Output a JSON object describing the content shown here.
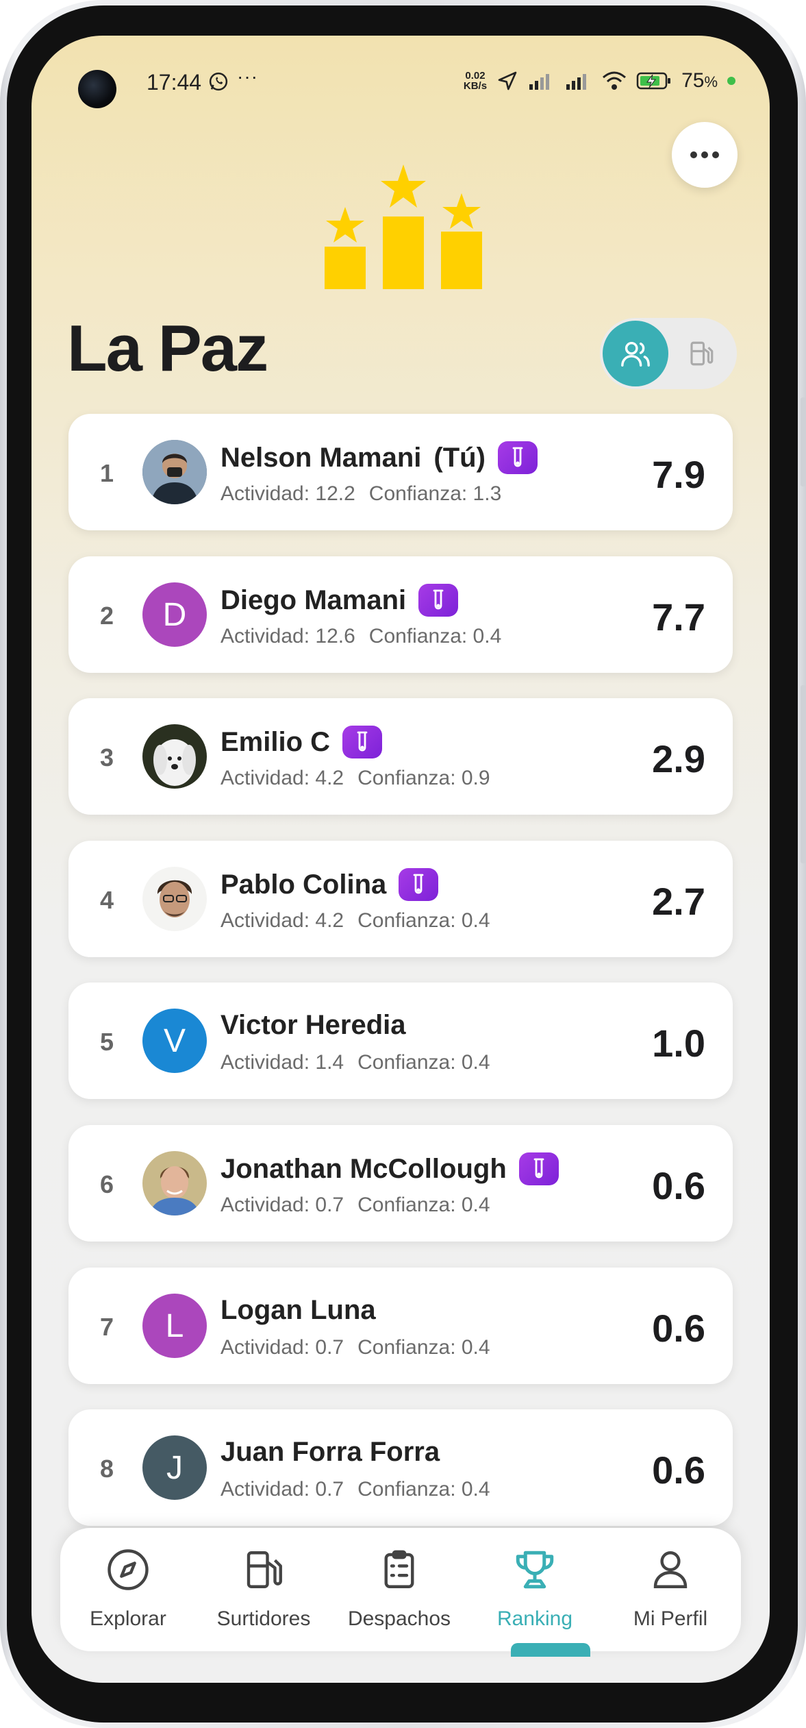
{
  "status_bar": {
    "time": "17:44",
    "more": "···",
    "net_speed_top": "0.02",
    "net_speed_bottom": "KB/s",
    "battery": "75",
    "battery_unit": "%"
  },
  "header": {
    "title": "La Paz"
  },
  "colors": {
    "accent": "#3aafb5",
    "trophy": "#ffd000",
    "badge": "#9230e0"
  },
  "ranking": [
    {
      "rank": "1",
      "name": "Nelson Mamani",
      "suffix": "(Tú)",
      "activity": "Actividad: 12.2",
      "trust": "Confianza: 1.3",
      "score": "7.9",
      "badge": true,
      "avatar": "photo"
    },
    {
      "rank": "2",
      "name": "Diego Mamani",
      "suffix": "",
      "activity": "Actividad: 12.6",
      "trust": "Confianza: 0.4",
      "score": "7.7",
      "badge": true,
      "avatar": "D",
      "avatar_color": "#ab47bc"
    },
    {
      "rank": "3",
      "name": "Emilio C",
      "suffix": "",
      "activity": "Actividad: 4.2",
      "trust": "Confianza: 0.9",
      "score": "2.9",
      "badge": true,
      "avatar": "photo"
    },
    {
      "rank": "4",
      "name": "Pablo Colina",
      "suffix": "",
      "activity": "Actividad: 4.2",
      "trust": "Confianza: 0.4",
      "score": "2.7",
      "badge": true,
      "avatar": "photo"
    },
    {
      "rank": "5",
      "name": "Victor Heredia",
      "suffix": "",
      "activity": "Actividad: 1.4",
      "trust": "Confianza: 0.4",
      "score": "1.0",
      "badge": false,
      "avatar": "V",
      "avatar_color": "#1a88d4"
    },
    {
      "rank": "6",
      "name": "Jonathan McCollough",
      "suffix": "",
      "activity": "Actividad: 0.7",
      "trust": "Confianza: 0.4",
      "score": "0.6",
      "badge": true,
      "avatar": "photo"
    },
    {
      "rank": "7",
      "name": "Logan Luna",
      "suffix": "",
      "activity": "Actividad: 0.7",
      "trust": "Confianza: 0.4",
      "score": "0.6",
      "badge": false,
      "avatar": "L",
      "avatar_color": "#ab47bc"
    },
    {
      "rank": "8",
      "name": "Juan Forra Forra",
      "suffix": "",
      "activity": "Actividad: 0.7",
      "trust": "Confianza: 0.4",
      "score": "0.6",
      "badge": false,
      "avatar": "J",
      "avatar_color": "#455a64"
    }
  ],
  "tabs": [
    {
      "label": "Explorar",
      "icon": "compass-icon"
    },
    {
      "label": "Surtidores",
      "icon": "fuel-pump-icon"
    },
    {
      "label": "Despachos",
      "icon": "clipboard-icon"
    },
    {
      "label": "Ranking",
      "icon": "trophy-icon",
      "active": true
    },
    {
      "label": "Mi Perfil",
      "icon": "user-icon"
    }
  ]
}
